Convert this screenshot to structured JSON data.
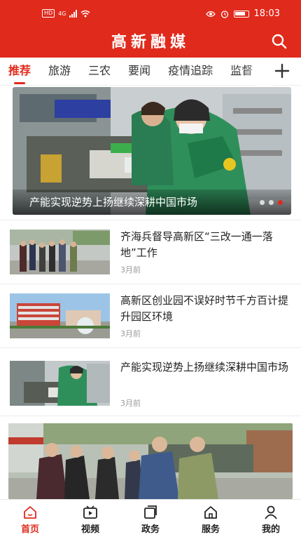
{
  "status_bar": {
    "network_label": "HD",
    "signal_label": "4G",
    "time": "18:03"
  },
  "header": {
    "title": "高新融媒",
    "search_icon": "search-icon"
  },
  "tabs": [
    {
      "label": "推荐",
      "active": true
    },
    {
      "label": "旅游",
      "active": false
    },
    {
      "label": "三农",
      "active": false
    },
    {
      "label": "要闻",
      "active": false
    },
    {
      "label": "疫情追踪",
      "active": false
    },
    {
      "label": "监督",
      "active": false
    }
  ],
  "add_tab_icon": "plus-icon",
  "banner": {
    "title": "产能实现逆势上扬继续深耕中国市场",
    "slide_count": 3,
    "active_slide": 3
  },
  "news": [
    {
      "title": "齐海兵督导高新区“三改一通一落地”工作",
      "time": "3月前"
    },
    {
      "title": "高新区创业园不误好时节千方百计提升园区环境",
      "time": "3月前"
    },
    {
      "title": "产能实现逆势上扬继续深耕中国市场",
      "time": "3月前"
    }
  ],
  "bottom_nav": [
    {
      "label": "首页",
      "icon": "home-icon",
      "active": true
    },
    {
      "label": "视频",
      "icon": "video-icon",
      "active": false
    },
    {
      "label": "政务",
      "icon": "government-icon",
      "active": false
    },
    {
      "label": "服务",
      "icon": "service-icon",
      "active": false
    },
    {
      "label": "我的",
      "icon": "profile-icon",
      "active": false
    }
  ],
  "colors": {
    "brand_red": "#e02a1c",
    "text": "#222222",
    "muted": "#999999"
  }
}
